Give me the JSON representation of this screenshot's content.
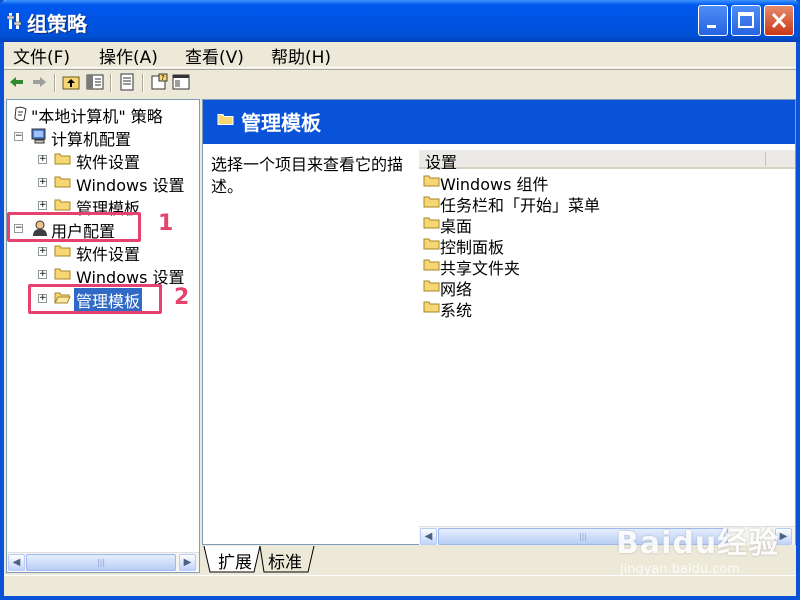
{
  "window": {
    "title": "组策略",
    "controls": [
      "minimize",
      "maximize",
      "close"
    ]
  },
  "menubar": {
    "items": [
      "文件(F)",
      "操作(A)",
      "查看(V)",
      "帮助(H)"
    ]
  },
  "toolbar": {
    "buttons": [
      "back-icon",
      "forward-icon",
      "up-folder-icon",
      "show-hide-tree-icon",
      "export-list-icon",
      "properties-icon",
      "help-icon"
    ]
  },
  "tree": {
    "root": "\"本地计算机\" 策略",
    "nodes": [
      {
        "label": "计算机配置",
        "level": 1,
        "expanded": true
      },
      {
        "label": "软件设置",
        "level": 2
      },
      {
        "label": "Windows 设置",
        "level": 2
      },
      {
        "label": "管理模板",
        "level": 2
      },
      {
        "label": "用户配置",
        "level": 1,
        "expanded": true
      },
      {
        "label": "软件设置",
        "level": 2
      },
      {
        "label": "Windows 设置",
        "level": 2
      },
      {
        "label": "管理模板",
        "level": 2,
        "selected": true
      }
    ]
  },
  "annotations": [
    "1",
    "2"
  ],
  "details": {
    "header": "管理模板",
    "description": "选择一个项目来查看它的描述。",
    "column": "设置",
    "items": [
      "Windows 组件",
      "任务栏和「开始」菜单",
      "桌面",
      "控制面板",
      "共享文件夹",
      "网络",
      "系统"
    ]
  },
  "tabs": [
    "扩展",
    "标准"
  ],
  "watermark": {
    "main": "Baidu经验",
    "sub": "jingyan.baidu.com"
  },
  "colors": {
    "titlebar": "#0054E3",
    "selection": "#316AC5",
    "annotation": "#E6426E",
    "folder": "#F7D774"
  }
}
